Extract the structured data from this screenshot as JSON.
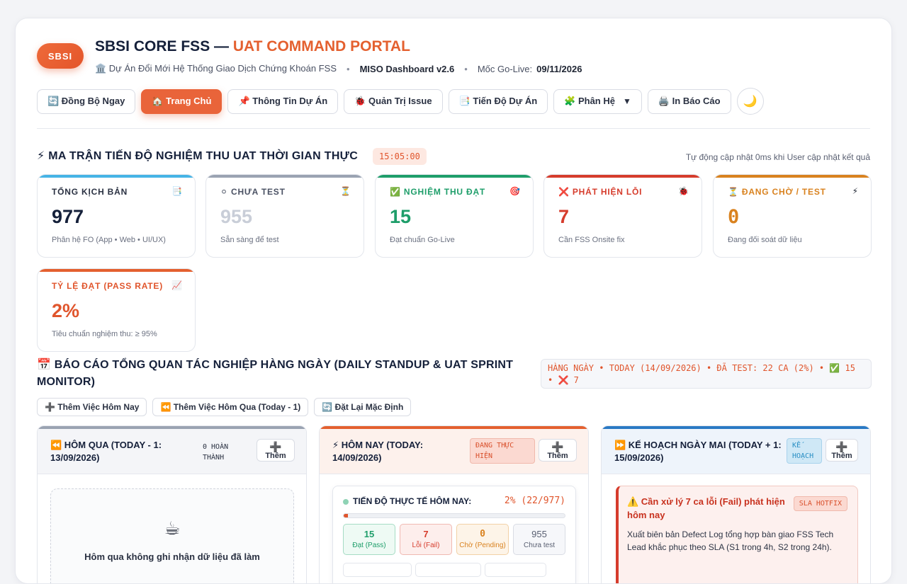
{
  "header": {
    "logo": "SBSI",
    "title_main": "SBSI CORE FSS —",
    "title_accent": "UAT COMMAND PORTAL",
    "subtitle_project": "🏛️ Dự Án Đổi Mới Hệ Thống Giao Dịch Chứng Khoán FSS",
    "subtitle_dashboard": "MISO Dashboard v2.6",
    "golive_label": "Mốc Go-Live:",
    "golive_date": "09/11/2026"
  },
  "nav": {
    "sync": "🔄 Đồng Bộ Ngay",
    "home": "🏠 Trang Chủ",
    "project_info": "📌 Thông Tin Dự Án",
    "issues": "🐞 Quản Trị Issue",
    "progress": "📑 Tiến Độ Dự Án",
    "modules": "🧩 Phân Hệ",
    "modules_caret": "▼",
    "print": "🖨️ In Báo Cáo",
    "theme": "🌙"
  },
  "matrix": {
    "title": "⚡ MA TRẬN TIẾN ĐỘ NGHIỆM THU UAT THỜI GIAN THỰC",
    "clock": "15:05:00",
    "auto_note": "Tự động cập nhật 0ms khi User cập nhật kết quả",
    "kpis": [
      {
        "label": "TỔNG KỊCH BẢN",
        "icon": "📑",
        "value": "977",
        "note": "Phân hệ FO (App • Web • UI/UX)"
      },
      {
        "label": "⚪ CHƯA TEST",
        "icon": "⏳",
        "value": "955",
        "note": "Sẵn sàng để test"
      },
      {
        "label": "✅ NGHIỆM THU ĐẠT",
        "icon": "🎯",
        "value": "15",
        "note": "Đạt chuẩn Go-Live"
      },
      {
        "label": "❌ PHÁT HIỆN LỖI",
        "icon": "🐞",
        "value": "7",
        "note": "Cần FSS Onsite fix"
      },
      {
        "label": "⏳ ĐANG CHỜ / TEST",
        "icon": "⚡",
        "value": "0",
        "note": "Đang đối soát dữ liệu"
      },
      {
        "label": "TỶ LỆ ĐẠT (PASS RATE)",
        "icon": "📈",
        "value": "2%",
        "note": "Tiêu chuẩn nghiệm thu: ≥ 95%"
      }
    ]
  },
  "daily": {
    "title": "📅 BÁO CÁO TỔNG QUAN TÁC NGHIỆP HÀNG NGÀY (DAILY STANDUP & UAT SPRINT MONITOR)",
    "status": "HÀNG NGÀY • TODAY (14/09/2026) • ĐÃ TEST: 22 CA (2%) • ✅ 15 • ❌ 7",
    "actions": {
      "add_today": "➕ Thêm Việc Hôm Nay",
      "add_yesterday": "⏪ Thêm Việc Hôm Qua (Today - 1)",
      "reset": "🔄 Đặt Lại Mặc Định"
    },
    "yesterday": {
      "title": "⏪ HÔM QUA (TODAY - 1: 13/09/2026)",
      "badge": "0 HOÀN THÀNH",
      "add_plus": "➕",
      "add_label": "Thêm",
      "empty_icon": "☕",
      "empty_text": "Hôm qua không ghi nhận dữ liệu đã làm"
    },
    "today": {
      "title": "⚡ HÔM NAY (TODAY: 14/09/2026)",
      "badge": "ĐANG THỰC HIỆN",
      "add_plus": "➕",
      "add_label": "Thêm",
      "progress_title": "TIẾN ĐỘ THỰC TẾ HÔM NAY:",
      "progress_value": "2% (22/977)",
      "progress_fraction": 0.02,
      "stats": [
        {
          "value": "15",
          "label": "Đạt (Pass)"
        },
        {
          "value": "7",
          "label": "Lỗi (Fail)"
        },
        {
          "value": "0",
          "label": "Chờ (Pending)"
        },
        {
          "value": "955",
          "label": "Chưa test"
        }
      ]
    },
    "tomorrow": {
      "title": "⏩ KẾ HOẠCH NGÀY MAI (TODAY + 1: 15/09/2026)",
      "badge": "KẾ HOẠCH",
      "add_plus": "➕",
      "add_label": "Thêm",
      "alert_title": "⚠️ Cần xử lý 7 ca lỗi (Fail) phát hiện hôm nay",
      "alert_badge": "SLA HOTFIX",
      "alert_body": "Xuất biên bản Defect Log tổng hợp bàn giao FSS Tech Lead khắc phục theo SLA (S1 trong 4h, S2 trong 24h)."
    }
  },
  "colors": {
    "accent": "#e4602f",
    "pass": "#1e9e6a",
    "fail": "#d63c2c",
    "pending": "#d9821f",
    "muted": "#c9ced8"
  }
}
